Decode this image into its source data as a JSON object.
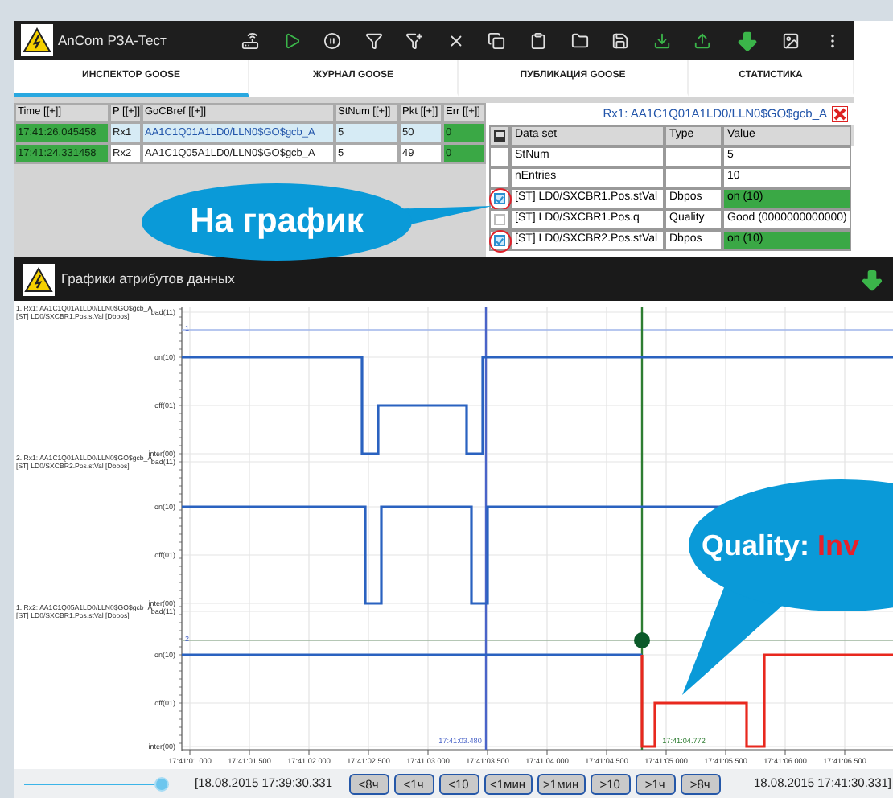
{
  "toolbar": {
    "title": "AnCom РЗА-Тест"
  },
  "tabs": [
    {
      "label": "ИНСПЕКТОР GOOSE",
      "selected": true
    },
    {
      "label": "ЖУРНАЛ GOOSE",
      "selected": false
    },
    {
      "label": "ПУБЛИКАЦИЯ GOOSE",
      "selected": false
    },
    {
      "label": "СТАТИСТИКА",
      "selected": false
    }
  ],
  "goose_table": {
    "columns": [
      "Time [[+]]",
      "P [[+]]",
      "GoCBref [[+]]",
      "StNum [[+]]",
      "Pkt [[+]]",
      "Err [[+]]"
    ],
    "rows": [
      {
        "selected": true,
        "cells": [
          "17:41:26.045458",
          "Rx1",
          "AA1C1Q01A1LD0/LLN0$GO$gcb_A",
          "5",
          "50",
          "0"
        ]
      },
      {
        "selected": false,
        "cells": [
          "17:41:24.331458",
          "Rx2",
          "AA1C1Q05A1LD0/LLN0$GO$gcb_A",
          "5",
          "49",
          "0"
        ]
      }
    ]
  },
  "dataset_panel": {
    "title": "Rx1: AA1C1Q01A1LD0/LLN0$GO$gcb_A",
    "columns": [
      "Data set",
      "Type",
      "Value"
    ],
    "rows": [
      {
        "kind": "plain",
        "name": "StNum",
        "value": "5",
        "highlighted": false
      },
      {
        "kind": "plain",
        "name": "nEntries",
        "value": "10",
        "highlighted": false
      },
      {
        "kind": "checkbox",
        "checked": true,
        "circled": true,
        "name": "[ST] LD0/SXCBR1.Pos.stVal",
        "type": "Dbpos",
        "value": "on (10)",
        "highlighted": true
      },
      {
        "kind": "checkbox",
        "checked": false,
        "circled": false,
        "name": "[ST] LD0/SXCBR1.Pos.q",
        "type": "Quality",
        "value": "Good (0000000000000)",
        "highlighted": false
      },
      {
        "kind": "checkbox",
        "checked": true,
        "circled": true,
        "name": "[ST] LD0/SXCBR2.Pos.stVal",
        "type": "Dbpos",
        "value": "on (10)",
        "highlighted": true
      }
    ]
  },
  "chart": {
    "title": "Графики атрибутов данных",
    "traces": [
      {
        "source": "1. Rx1: AA1C1Q01A1LD0/LLN0$GO$gcb_A",
        "signal": "[ST] LD0/SXCBR1.Pos.stVal [Dbpos]",
        "levels": [
          "bad(11)",
          "on(10)",
          "off(01)",
          "inter(00)"
        ],
        "marker": "1"
      },
      {
        "source": "2. Rx1: AA1C1Q01A1LD0/LLN0$GO$gcb_A",
        "signal": "[ST] LD0/SXCBR2.Pos.stVal [Dbpos]",
        "levels": [
          "bad(11)",
          "on(10)",
          "off(01)",
          "inter(00)"
        ]
      },
      {
        "source": "1. Rx2: AA1C1Q05A1LD0/LLN0$GO$gcb_A",
        "signal": "[ST] LD0/SXCBR1.Pos.stVal [Dbpos]",
        "levels": [
          "bad(11)",
          "on(10)",
          "off(01)",
          "inter(00)"
        ],
        "marker": "2"
      }
    ],
    "xticks": [
      "17:41:01.000",
      "17:41:01.500",
      "17:41:02.000",
      "17:41:02.500",
      "17:41:03.000",
      "17:41:03.500",
      "17:41:04.000",
      "17:41:04.500",
      "17:41:05.000",
      "17:41:05.500",
      "17:41:06.000",
      "17:41:06.500"
    ],
    "cursors": [
      {
        "time": "17:41:03.480"
      },
      {
        "time": "17:41:04.772"
      }
    ]
  },
  "timeline": {
    "level": 1,
    "start": "[18.08.2015 17:39:30.331",
    "end": "18.08.2015 17:41:30.331]",
    "buttons": [
      "<8ч",
      "<1ч",
      "<10",
      "<1мин",
      ">1мин",
      ">10",
      ">1ч",
      ">8ч"
    ]
  },
  "callouts": {
    "graph": "На график",
    "quality_label": "Quality:",
    "quality_value": "Inv"
  }
}
